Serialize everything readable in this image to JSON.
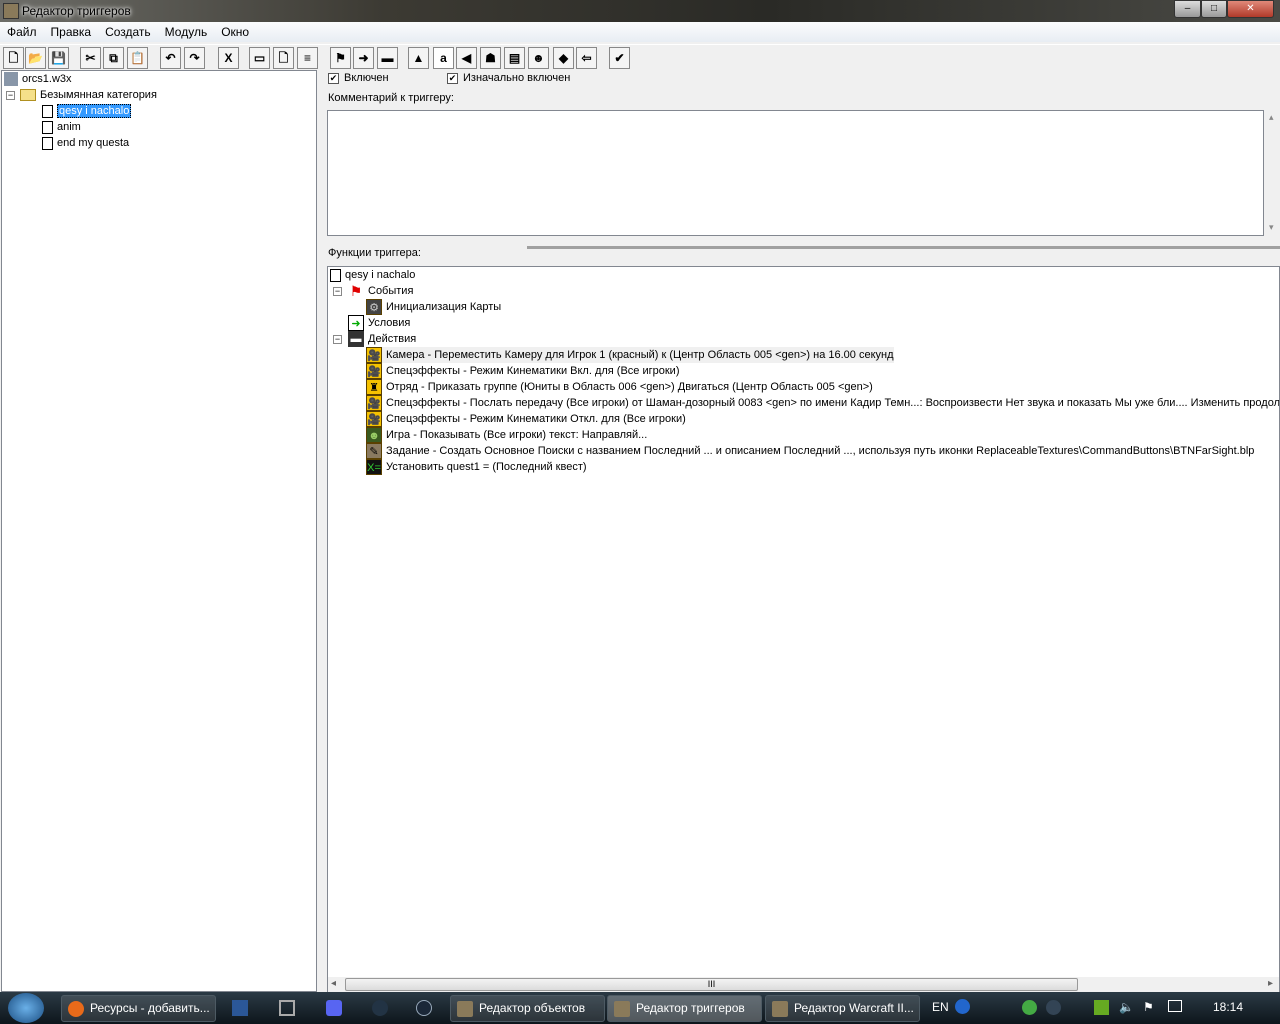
{
  "window": {
    "title": "Редактор триггеров",
    "min": "–",
    "max": "□",
    "close": "✕"
  },
  "menu": [
    "Файл",
    "Правка",
    "Создать",
    "Модуль",
    "Окно"
  ],
  "toolbar": [
    {
      "name": "new-icon",
      "g": "🗋"
    },
    {
      "name": "open-icon",
      "g": "📂"
    },
    {
      "name": "save-icon",
      "g": "💾"
    },
    {
      "name": "cut-icon",
      "g": "✂"
    },
    {
      "name": "copy-icon",
      "g": "⧉"
    },
    {
      "name": "paste-icon",
      "g": "📋"
    },
    {
      "name": "undo-icon",
      "g": "↶"
    },
    {
      "name": "redo-icon",
      "g": "↷"
    },
    {
      "name": "variables-icon",
      "g": "X"
    },
    {
      "name": "new-category-icon",
      "g": "▭"
    },
    {
      "name": "new-trigger-icon",
      "g": "🗋"
    },
    {
      "name": "new-comment-icon",
      "g": "≡"
    },
    {
      "name": "new-event-icon",
      "g": "⚑"
    },
    {
      "name": "new-condition-icon",
      "g": "➜"
    },
    {
      "name": "new-action-icon",
      "g": "▬"
    },
    {
      "name": "terrain-editor-icon",
      "g": "▲"
    },
    {
      "name": "trigger-editor-icon",
      "g": "a"
    },
    {
      "name": "sound-editor-icon",
      "g": "◀"
    },
    {
      "name": "object-editor-icon",
      "g": "☗"
    },
    {
      "name": "campaign-editor-icon",
      "g": "▤"
    },
    {
      "name": "ai-editor-icon",
      "g": "☻"
    },
    {
      "name": "object-manager-icon",
      "g": "◆"
    },
    {
      "name": "import-manager-icon",
      "g": "⇦"
    },
    {
      "name": "test-map-icon",
      "g": "✔"
    }
  ],
  "left_tree": {
    "map": "orcs1.w3x",
    "category": "Безымянная категория",
    "triggers": [
      "qesy i nachalo",
      "anim",
      "end my questa"
    ]
  },
  "trigger": {
    "enabled_label": "Включен",
    "initially_on_label": "Изначально включен",
    "enabled": true,
    "initially_on": true,
    "comment_label": "Комментарий к триггеру:",
    "comment": "",
    "functions_label": "Функции триггера:"
  },
  "functions": {
    "root": "qesy i nachalo",
    "events_label": "События",
    "events": [
      "Инициализация Карты"
    ],
    "conditions_label": "Условия",
    "actions_label": "Действия",
    "actions": [
      {
        "text": "Камера - Переместить Камеру для Игрок 1 (красный) к (Центр Область 005 <gen>) на 16.00 секунд",
        "icon": "camera-icon",
        "g": "🎥"
      },
      {
        "text": "Спецэффекты - Режим Кинематики Вкл. для  (Все игроки)",
        "icon": "cinematic-icon",
        "g": "🎥"
      },
      {
        "text": "Отряд - Приказать группе (Юниты в Область 006 <gen>) Двигаться (Центр Область 005 <gen>)",
        "icon": "unit-group-icon",
        "g": "♜"
      },
      {
        "text": "Спецэффекты - Послать передачу (Все игроки) от Шаман-дозорный 0083 <gen> по имени Кадир Темн...: Воспроизвести Нет звука и показать Мы уже бли....  Изменить продолжительность",
        "icon": "cinematic-icon",
        "g": "🎥"
      },
      {
        "text": "Спецэффекты - Режим Кинематики Откл. для  (Все игроки)",
        "icon": "cinematic-icon",
        "g": "🎥"
      },
      {
        "text": "Игра - Показывать (Все игроки) текст: Направляй...",
        "icon": "game-icon",
        "g": "☻"
      },
      {
        "text": "Задание - Создать Основное Поиски с названием Последний ... и описанием Последний ..., используя путь иконки ReplaceableTextures\\CommandButtons\\BTNFarSight.blp",
        "icon": "quest-icon",
        "g": "✎"
      },
      {
        "text": "Установить quest1 = (Последний квест)",
        "icon": "set-variable-icon",
        "g": "X="
      }
    ]
  },
  "scroll": {
    "grip": "III",
    "left": "◂",
    "right": "▸",
    "up": "▴",
    "down": "▾"
  },
  "taskbar": {
    "tasks": [
      "Ресурсы - добавить...",
      "Редактор объектов",
      "Редактор триггеров",
      "Редактор Warcraft II..."
    ],
    "lang": "EN",
    "clock": "18:14"
  }
}
